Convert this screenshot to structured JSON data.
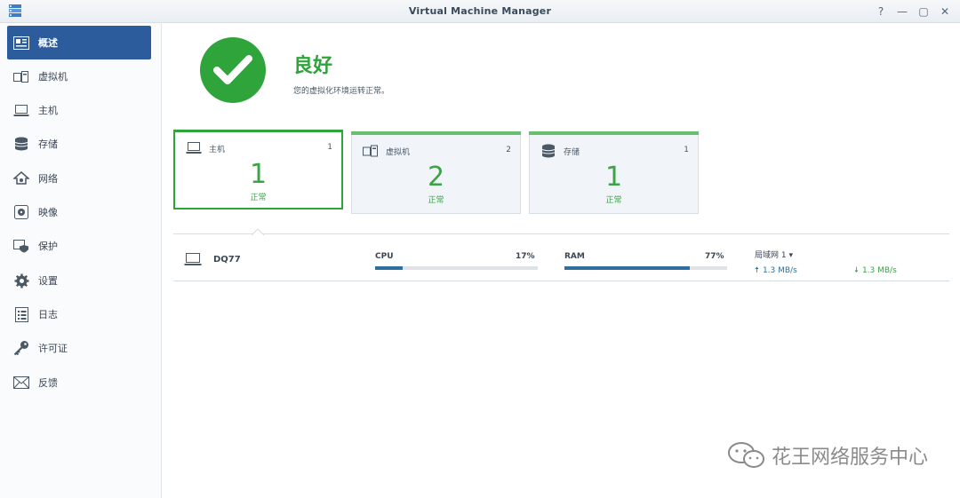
{
  "window": {
    "title": "Virtual Machine Manager",
    "buttons": [
      "?",
      "—",
      "▢",
      "✕"
    ]
  },
  "sidebar": {
    "items": [
      {
        "label": "概述",
        "icon": "overview-icon",
        "active": true
      },
      {
        "label": "虚拟机",
        "icon": "vm-icon"
      },
      {
        "label": "主机",
        "icon": "host-icon"
      },
      {
        "label": "存储",
        "icon": "storage-icon"
      },
      {
        "label": "网络",
        "icon": "network-icon"
      },
      {
        "label": "映像",
        "icon": "image-icon"
      },
      {
        "label": "保护",
        "icon": "protection-icon"
      },
      {
        "label": "设置",
        "icon": "gear-icon"
      },
      {
        "label": "日志",
        "icon": "log-icon"
      },
      {
        "label": "许可证",
        "icon": "key-icon"
      },
      {
        "label": "反馈",
        "icon": "mail-icon"
      }
    ]
  },
  "status": {
    "title": "良好",
    "description": "您的虚拟化环境运转正常。",
    "color": "#2ea43b"
  },
  "cards": [
    {
      "label": "主机",
      "count": "1",
      "big": "1",
      "sub": "正常",
      "selected": true
    },
    {
      "label": "虚拟机",
      "count": "2",
      "big": "2",
      "sub": "正常"
    },
    {
      "label": "存储",
      "count": "1",
      "big": "1",
      "sub": "正常"
    }
  ],
  "host": {
    "name": "DQ77",
    "cpu": {
      "label": "CPU",
      "value": "17%",
      "fraction": 0.17
    },
    "ram": {
      "label": "RAM",
      "value": "77%",
      "fraction": 0.77
    },
    "network": {
      "label": "局域网 1",
      "up": "1.3 MB/s",
      "down": "1.3 MB/s"
    }
  },
  "watermark": {
    "text": "花王网络服务中心"
  }
}
